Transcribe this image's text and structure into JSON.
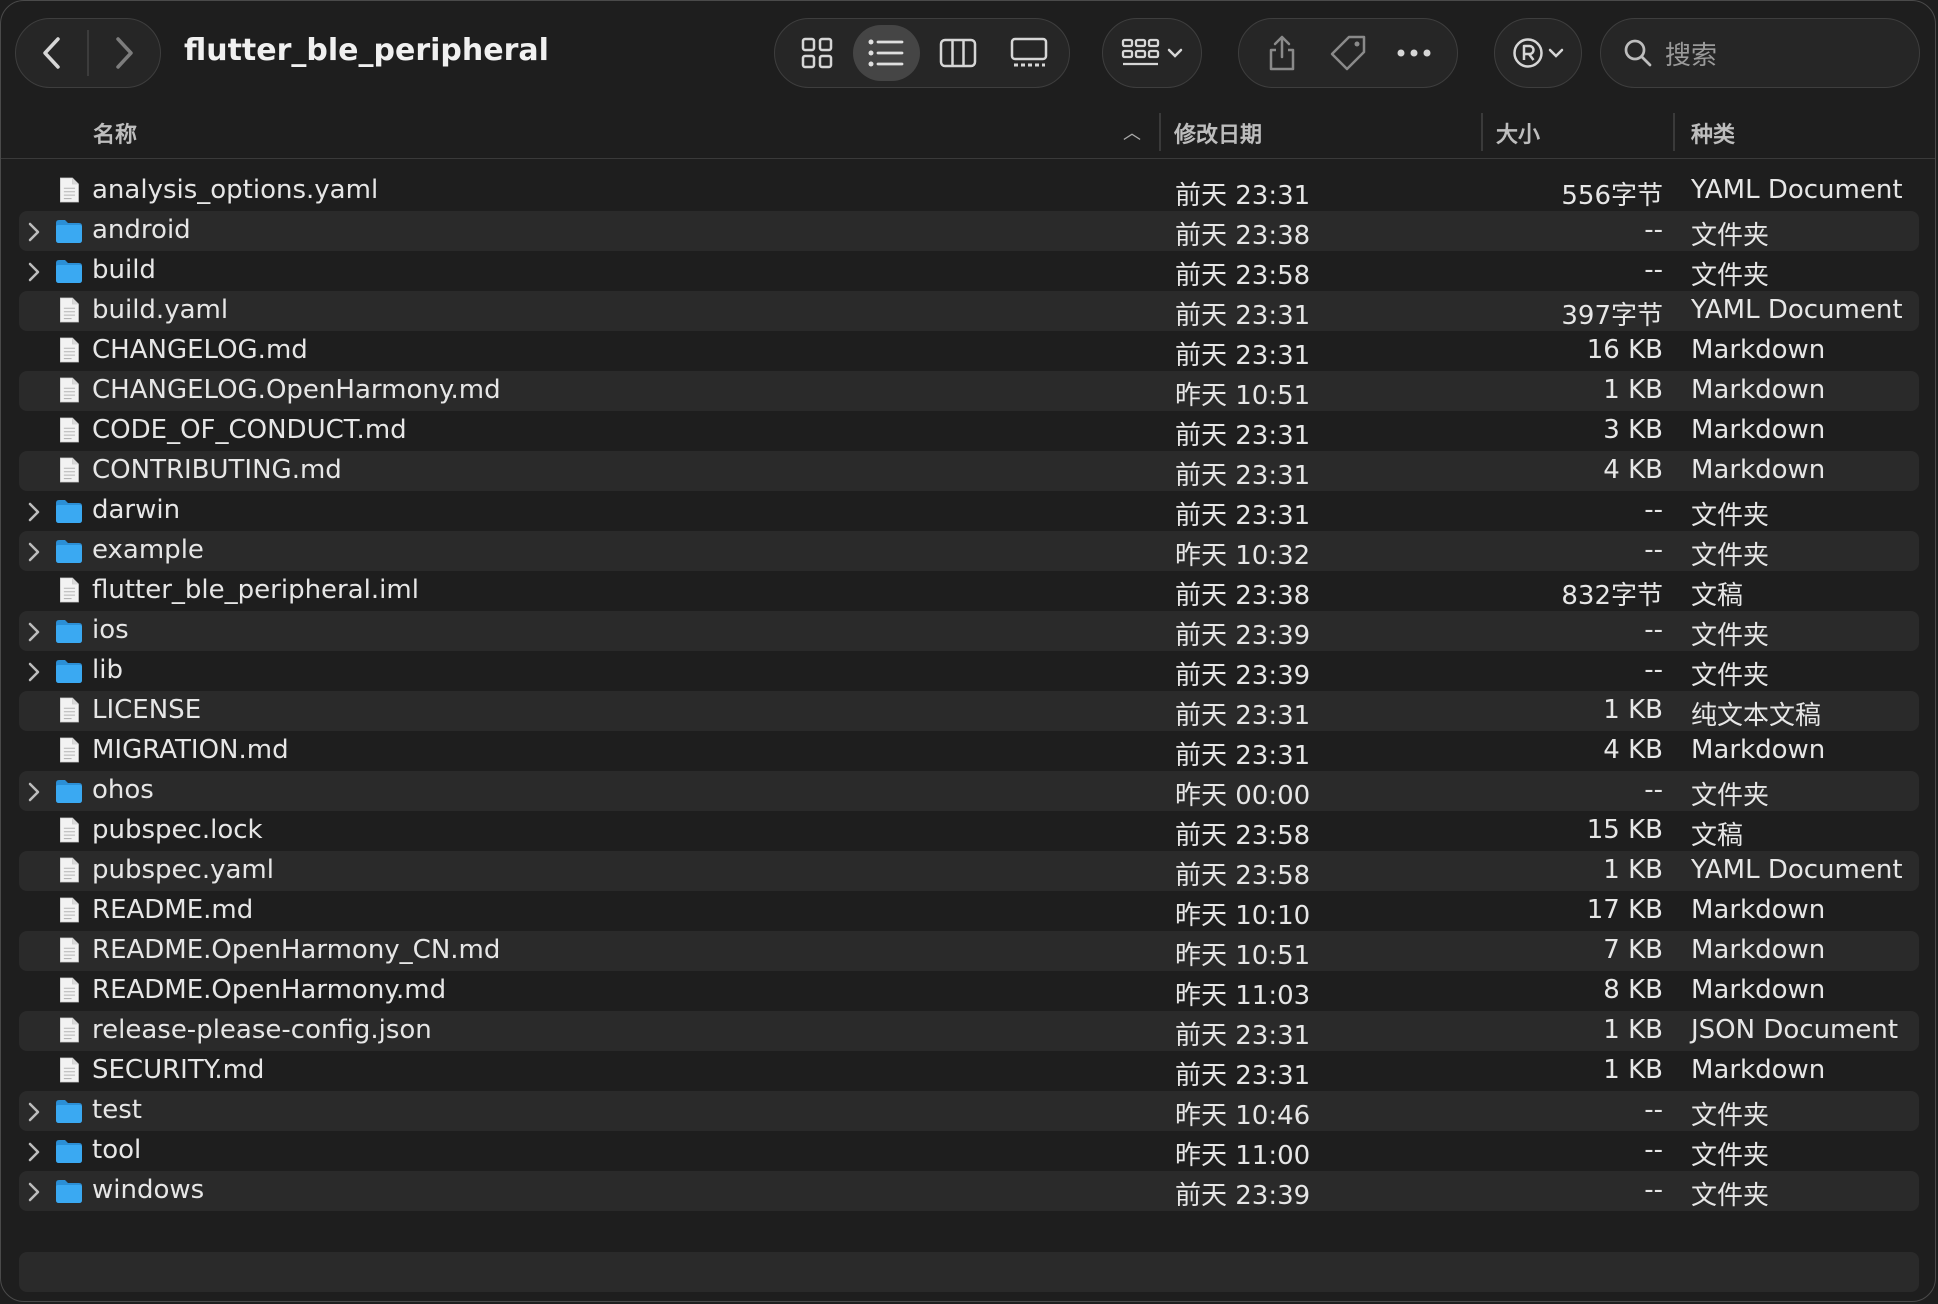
{
  "window": {
    "title": "flutter_ble_peripheral"
  },
  "toolbar": {
    "search_placeholder": "搜索"
  },
  "columns": {
    "name": "名称",
    "date": "修改日期",
    "size": "大小",
    "kind": "种类"
  },
  "files": [
    {
      "name": "analysis_options.yaml",
      "date": "前天 23:31",
      "size": "556字节",
      "kind": "YAML Document",
      "folder": false
    },
    {
      "name": "android",
      "date": "前天 23:38",
      "size": "--",
      "kind": "文件夹",
      "folder": true
    },
    {
      "name": "build",
      "date": "前天 23:58",
      "size": "--",
      "kind": "文件夹",
      "folder": true
    },
    {
      "name": "build.yaml",
      "date": "前天 23:31",
      "size": "397字节",
      "kind": "YAML Document",
      "folder": false
    },
    {
      "name": "CHANGELOG.md",
      "date": "前天 23:31",
      "size": "16 KB",
      "kind": "Markdown",
      "folder": false
    },
    {
      "name": "CHANGELOG.OpenHarmony.md",
      "date": "昨天 10:51",
      "size": "1 KB",
      "kind": "Markdown",
      "folder": false
    },
    {
      "name": "CODE_OF_CONDUCT.md",
      "date": "前天 23:31",
      "size": "3 KB",
      "kind": "Markdown",
      "folder": false
    },
    {
      "name": "CONTRIBUTING.md",
      "date": "前天 23:31",
      "size": "4 KB",
      "kind": "Markdown",
      "folder": false
    },
    {
      "name": "darwin",
      "date": "前天 23:31",
      "size": "--",
      "kind": "文件夹",
      "folder": true
    },
    {
      "name": "example",
      "date": "昨天 10:32",
      "size": "--",
      "kind": "文件夹",
      "folder": true
    },
    {
      "name": "flutter_ble_peripheral.iml",
      "date": "前天 23:38",
      "size": "832字节",
      "kind": "文稿",
      "folder": false
    },
    {
      "name": "ios",
      "date": "前天 23:39",
      "size": "--",
      "kind": "文件夹",
      "folder": true
    },
    {
      "name": "lib",
      "date": "前天 23:39",
      "size": "--",
      "kind": "文件夹",
      "folder": true
    },
    {
      "name": "LICENSE",
      "date": "前天 23:31",
      "size": "1 KB",
      "kind": "纯文本文稿",
      "folder": false
    },
    {
      "name": "MIGRATION.md",
      "date": "前天 23:31",
      "size": "4 KB",
      "kind": "Markdown",
      "folder": false
    },
    {
      "name": "ohos",
      "date": "昨天 00:00",
      "size": "--",
      "kind": "文件夹",
      "folder": true
    },
    {
      "name": "pubspec.lock",
      "date": "前天 23:58",
      "size": "15 KB",
      "kind": "文稿",
      "folder": false
    },
    {
      "name": "pubspec.yaml",
      "date": "前天 23:58",
      "size": "1 KB",
      "kind": "YAML Document",
      "folder": false
    },
    {
      "name": "README.md",
      "date": "昨天 10:10",
      "size": "17 KB",
      "kind": "Markdown",
      "folder": false
    },
    {
      "name": "README.OpenHarmony_CN.md",
      "date": "昨天 10:51",
      "size": "7 KB",
      "kind": "Markdown",
      "folder": false
    },
    {
      "name": "README.OpenHarmony.md",
      "date": "昨天 11:03",
      "size": "8 KB",
      "kind": "Markdown",
      "folder": false
    },
    {
      "name": "release-please-config.json",
      "date": "前天 23:31",
      "size": "1 KB",
      "kind": "JSON Document",
      "folder": false
    },
    {
      "name": "SECURITY.md",
      "date": "前天 23:31",
      "size": "1 KB",
      "kind": "Markdown",
      "folder": false
    },
    {
      "name": "test",
      "date": "昨天 10:46",
      "size": "--",
      "kind": "文件夹",
      "folder": true
    },
    {
      "name": "tool",
      "date": "昨天 11:00",
      "size": "--",
      "kind": "文件夹",
      "folder": true
    },
    {
      "name": "windows",
      "date": "前天 23:39",
      "size": "--",
      "kind": "文件夹",
      "folder": true
    }
  ],
  "colors": {
    "background": "#1e1e1e",
    "row_alt": "#2a2a2a",
    "folder": "#3aa9f2",
    "text": "#e6e6e6",
    "secondary_text": "#bdbdbd"
  }
}
